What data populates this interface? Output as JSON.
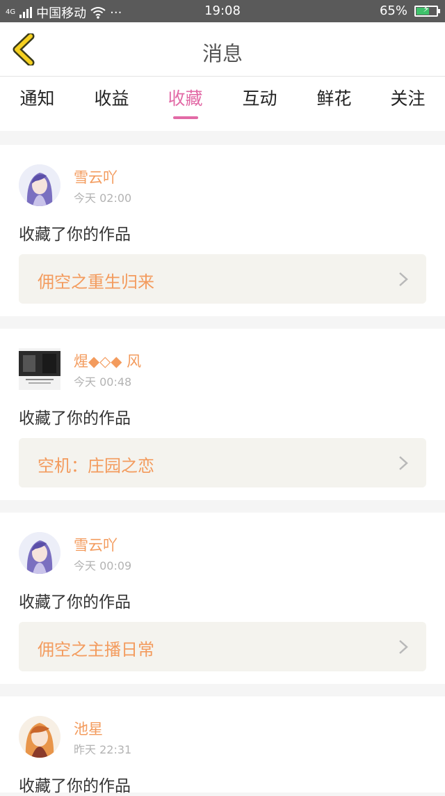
{
  "status_bar": {
    "network": "4G",
    "carrier": "中国移动",
    "more": "···",
    "time": "19:08",
    "battery": "65%",
    "battery_level": 0.65
  },
  "header": {
    "back_icon": "chevron-left-icon",
    "title": "消息"
  },
  "tabs": [
    {
      "label": "通知",
      "active": false
    },
    {
      "label": "收益",
      "active": false
    },
    {
      "label": "收藏",
      "active": true
    },
    {
      "label": "互动",
      "active": false
    },
    {
      "label": "鲜花",
      "active": false
    },
    {
      "label": "关注",
      "active": false
    }
  ],
  "messages": [
    {
      "user": "雪云吖",
      "time": "今天 02:00",
      "action": "收藏了你的作品",
      "work": "佣空之重生归来",
      "avatar": "anime-girl-purple"
    },
    {
      "user": "煋◆◇◆ 风",
      "time": "今天 00:48",
      "action": "收藏了你的作品",
      "work": "空机：庄园之恋",
      "avatar": "dark-photo"
    },
    {
      "user": "雪云吖",
      "time": "今天 00:09",
      "action": "收藏了你的作品",
      "work": "佣空之主播日常",
      "avatar": "anime-girl-purple"
    },
    {
      "user": "池星",
      "time": "昨天 22:31",
      "action": "收藏了你的作品",
      "work": "",
      "avatar": "anime-girl-orange"
    }
  ],
  "colors": {
    "accent": "#e26aa6",
    "username": "#f39b5d",
    "work_bg": "#f4f3ee",
    "back_icon": "#f5d020"
  }
}
